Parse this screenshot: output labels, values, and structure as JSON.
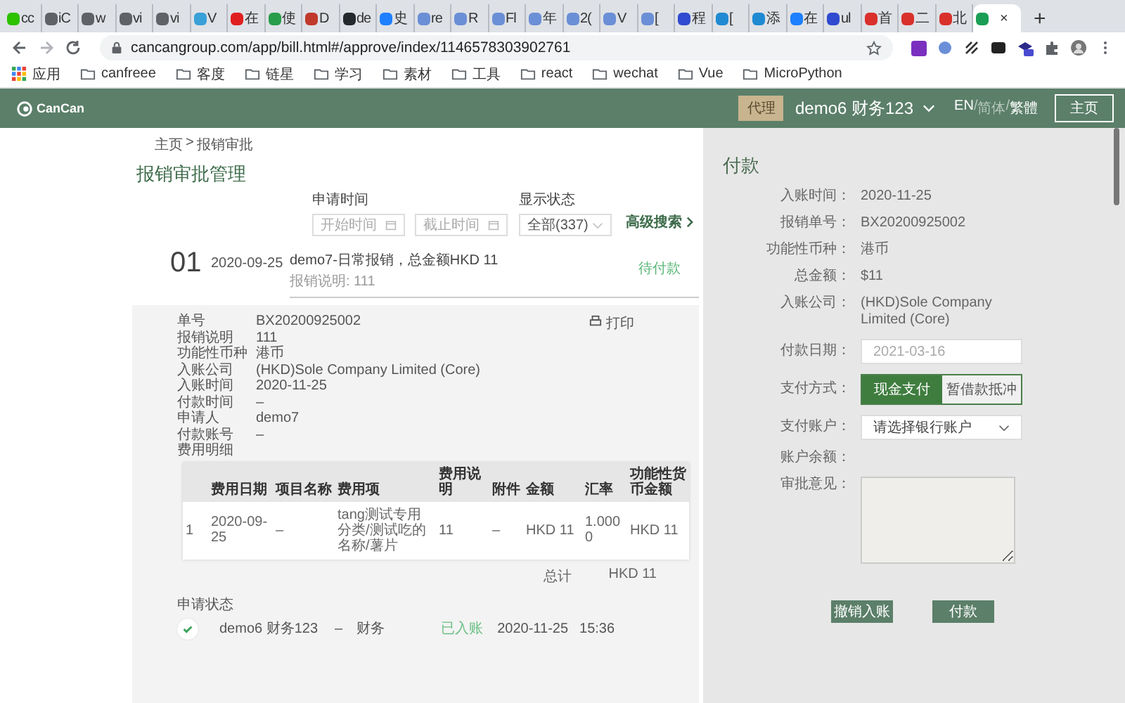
{
  "browser": {
    "tabs": [
      {
        "label": "cc",
        "color": "#2dc100",
        "selected": false
      },
      {
        "label": "iC",
        "color": "#5f6368",
        "selected": false
      },
      {
        "label": "w",
        "color": "#5f6368",
        "selected": false
      },
      {
        "label": "vi",
        "color": "#5f6368",
        "selected": false
      },
      {
        "label": "vi",
        "color": "#5f6368",
        "selected": false
      },
      {
        "label": "V",
        "color": "#3aa0d8",
        "selected": false
      },
      {
        "label": "在",
        "color": "#e02020",
        "selected": false
      },
      {
        "label": "使",
        "color": "#2a9d4b",
        "selected": false
      },
      {
        "label": "D",
        "color": "#c0392b",
        "selected": false
      },
      {
        "label": "de",
        "color": "#24292e",
        "selected": false
      },
      {
        "label": "史",
        "color": "#1e80ff",
        "selected": false
      },
      {
        "label": "re",
        "color": "#6b8fd6",
        "selected": false
      },
      {
        "label": "R",
        "color": "#6b8fd6",
        "selected": false
      },
      {
        "label": "Fl",
        "color": "#6b8fd6",
        "selected": false
      },
      {
        "label": "年",
        "color": "#6b8fd6",
        "selected": false
      },
      {
        "label": "2(",
        "color": "#6b8fd6",
        "selected": false
      },
      {
        "label": "V",
        "color": "#6b8fd6",
        "selected": false
      },
      {
        "label": "[",
        "color": "#6b8fd6",
        "selected": false
      },
      {
        "label": "程",
        "color": "#2f4ad0",
        "selected": false
      },
      {
        "label": "[",
        "color": "#1f8ad2",
        "selected": false
      },
      {
        "label": "添",
        "color": "#1f8ad2",
        "selected": false
      },
      {
        "label": "在",
        "color": "#1e80ff",
        "selected": false
      },
      {
        "label": "ul",
        "color": "#2f4ad0",
        "selected": false
      },
      {
        "label": "首",
        "color": "#d9302c",
        "selected": false
      },
      {
        "label": "二",
        "color": "#d9302c",
        "selected": false
      },
      {
        "label": "北",
        "color": "#d9302c",
        "selected": false
      },
      {
        "label": "×",
        "color": "#1a9e55",
        "selected": true
      }
    ],
    "new_tab": "+",
    "url": "cancangroup.com/app/bill.html#/approve/index/1146578303902761",
    "bookmarks": [
      {
        "label": "应用",
        "kind": "apps"
      },
      {
        "label": "canfreee",
        "kind": "folder"
      },
      {
        "label": "客度",
        "kind": "folder"
      },
      {
        "label": "链星",
        "kind": "folder"
      },
      {
        "label": "学习",
        "kind": "folder"
      },
      {
        "label": "素材",
        "kind": "folder"
      },
      {
        "label": "工具",
        "kind": "folder"
      },
      {
        "label": "react",
        "kind": "folder"
      },
      {
        "label": "wechat",
        "kind": "folder"
      },
      {
        "label": "Vue",
        "kind": "folder"
      },
      {
        "label": "MicroPython",
        "kind": "folder"
      }
    ]
  },
  "header": {
    "logo": "CanCan",
    "badge": "代理",
    "user": "demo6 财务123",
    "languages": [
      {
        "label": "EN",
        "selected": true
      },
      {
        "label": "简体",
        "selected": false
      },
      {
        "label": "繁體",
        "selected": true
      }
    ],
    "language_separator": "/",
    "home_button": "主页"
  },
  "breadcrumb": [
    "主页",
    "报销审批"
  ],
  "breadcrumb_separator": ">",
  "title": "报销审批管理",
  "filters": {
    "date_label": "申请时间",
    "start_placeholder": "开始时间",
    "end_placeholder": "截止时间",
    "status_label": "显示状态",
    "status_value": "全部(337)",
    "advanced": "高级搜索"
  },
  "record": {
    "index": "01",
    "date": "2020-09-25",
    "title": "demo7-日常报销，总金额HKD 11",
    "description": "报销说明: 111",
    "status": "待付款",
    "print": "打印",
    "details": [
      {
        "label": "单号",
        "value": "BX20200925002"
      },
      {
        "label": "报销说明",
        "value": "111"
      },
      {
        "label": "功能性币种",
        "value": "港币"
      },
      {
        "label": "入账公司",
        "value": "(HKD)Sole Company Limited (Core)"
      },
      {
        "label": "入账时间",
        "value": "2020-11-25"
      },
      {
        "label": "付款时间",
        "value": "–"
      },
      {
        "label": "申请人",
        "value": "demo7"
      },
      {
        "label": "付款账号",
        "value": "–"
      }
    ],
    "expense_label": "费用明细",
    "table": {
      "columns": [
        "费用日期",
        "项目名称",
        "费用项",
        "费用说明",
        "附件",
        "金额",
        "汇率",
        "功能性货币金额"
      ],
      "rows": [
        {
          "index": "1",
          "cells": [
            "2020-09-25",
            "–",
            "tang测试专用分类/测试吃的名称/薯片",
            "11",
            "–",
            "HKD 11",
            "1.0000",
            "HKD 11"
          ]
        }
      ]
    },
    "total_label": "总计",
    "total_value": "HKD 11",
    "status_title": "申请状态",
    "steps": [
      {
        "done": true,
        "user": "demo6 财务123",
        "dash": "–",
        "role": "财务",
        "status": "已入账",
        "date": "2020-11-25",
        "time": "15:36"
      }
    ]
  },
  "payment": {
    "title": "付款",
    "info": [
      {
        "label": "入账时间：",
        "value": "2020-11-25"
      },
      {
        "label": "报销单号：",
        "value": "BX20200925002"
      },
      {
        "label": "功能性币种：",
        "value": "港币"
      },
      {
        "label": "总金额：",
        "value": "$11"
      },
      {
        "label": "入账公司：",
        "value": "(HKD)Sole Company Limited (Core)"
      }
    ],
    "date_label": "付款日期：",
    "date_value": "2021-03-16",
    "method_label": "支付方式：",
    "methods": [
      {
        "label": "现金支付",
        "selected": true
      },
      {
        "label": "暂借款抵冲",
        "selected": false
      }
    ],
    "account_label": "支付账户：",
    "account_placeholder": "请选择银行账户",
    "balance_label": "账户余额：",
    "comment_label": "审批意见：",
    "buttons": [
      "撤销入账",
      "付款"
    ]
  }
}
